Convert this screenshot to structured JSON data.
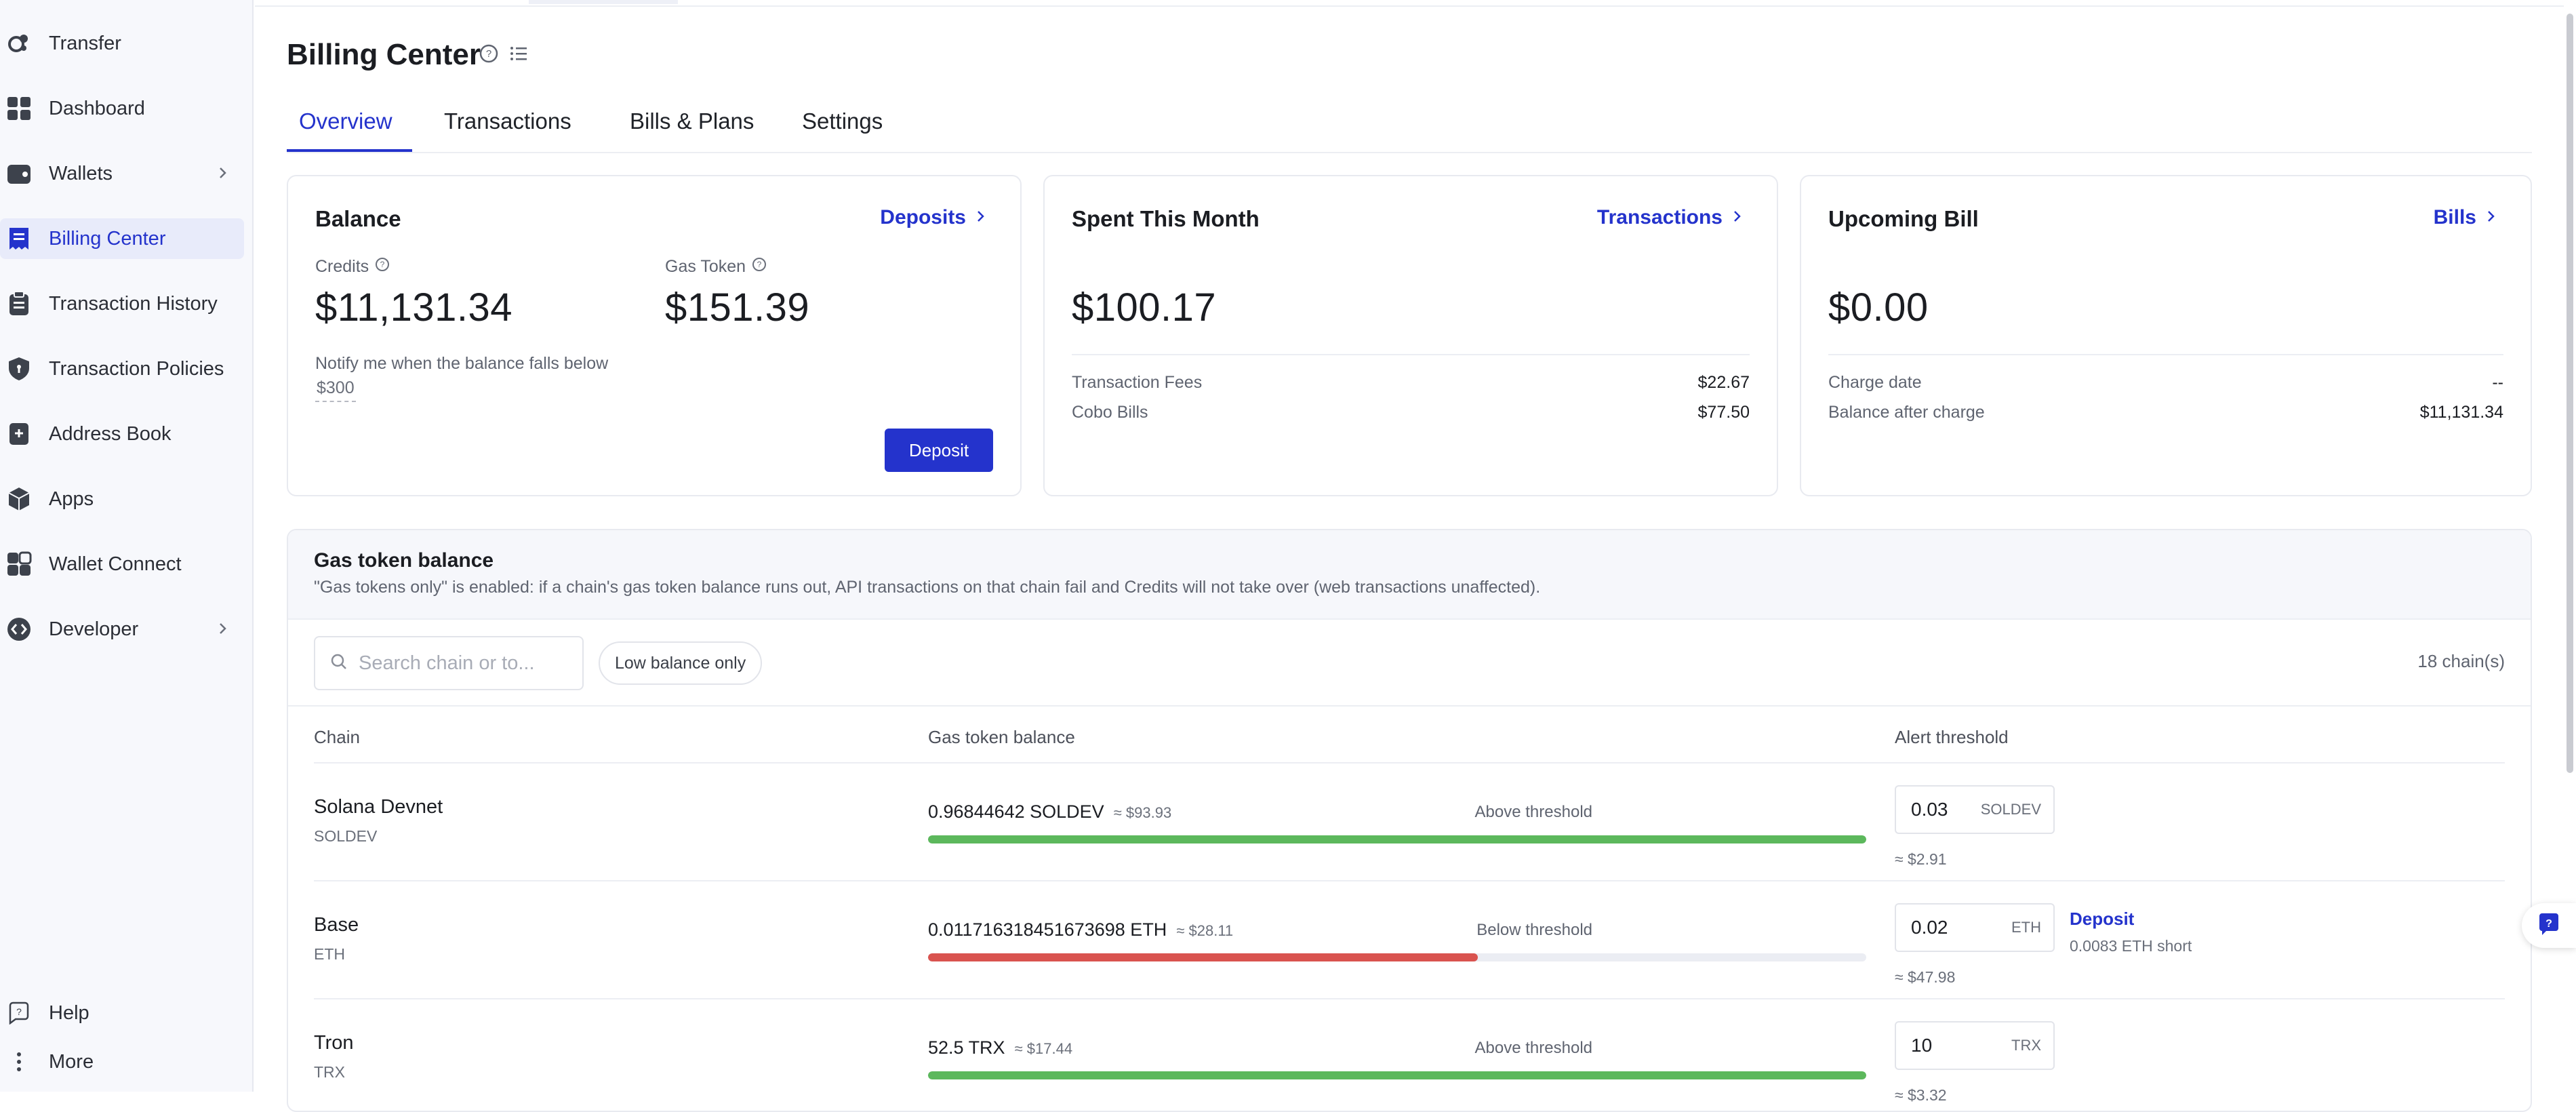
{
  "sidebar": {
    "items": [
      {
        "label": "Transfer",
        "icon": "transfer-icon"
      },
      {
        "label": "Dashboard",
        "icon": "dashboard-icon"
      },
      {
        "label": "Wallets",
        "icon": "wallet-icon"
      },
      {
        "label": "Billing Center",
        "icon": "billing-icon"
      },
      {
        "label": "Transaction History",
        "icon": "clipboard-icon"
      },
      {
        "label": "Transaction Policies",
        "icon": "shield-icon"
      },
      {
        "label": "Address Book",
        "icon": "address-book-icon"
      },
      {
        "label": "Apps",
        "icon": "cube-icon"
      },
      {
        "label": "Wallet Connect",
        "icon": "wallet-connect-icon"
      },
      {
        "label": "Developer",
        "icon": "code-icon"
      }
    ],
    "help": "Help",
    "more": "More"
  },
  "page": {
    "title": "Billing Center",
    "tabs": [
      "Overview",
      "Transactions",
      "Bills & Plans",
      "Settings"
    ]
  },
  "balance": {
    "title": "Balance",
    "link": "Deposits",
    "credits_label": "Credits",
    "credits": "$11,131.34",
    "gas_label": "Gas Token",
    "gas": "$151.39",
    "notify": "Notify me when the balance falls below",
    "notify_value": "$300",
    "deposit_button": "Deposit"
  },
  "spent": {
    "title": "Spent This Month",
    "link": "Transactions",
    "amount": "$100.17",
    "rows": [
      {
        "label": "Transaction Fees",
        "value": "$22.67"
      },
      {
        "label": "Cobo Bills",
        "value": "$77.50"
      }
    ]
  },
  "upcoming": {
    "title": "Upcoming Bill",
    "link": "Bills",
    "amount": "$0.00",
    "rows": [
      {
        "label": "Charge date",
        "value": "--"
      },
      {
        "label": "Balance after charge",
        "value": "$11,131.34"
      }
    ]
  },
  "gas_panel": {
    "title": "Gas token balance",
    "description": "\"Gas tokens only\" is enabled: if a chain's gas token balance runs out, API transactions on that chain fail and Credits will not take over (web transactions unaffected).",
    "search_placeholder": "Search chain or to...",
    "low_balance_chip": "Low balance only",
    "chain_count": "18 chain(s)",
    "headers": {
      "chain": "Chain",
      "balance": "Gas token balance",
      "alert": "Alert threshold"
    },
    "rows": [
      {
        "chain": "Solana Devnet",
        "symbol": "SOLDEV",
        "balance": "0.96844642 SOLDEV",
        "usd": "≈ $93.93",
        "status": "Above threshold",
        "level": 1.0,
        "bar_color": "#5cb85c",
        "threshold": "0.03",
        "unit": "SOLDEV",
        "threshold_usd": "≈ $2.91"
      },
      {
        "chain": "Base",
        "symbol": "ETH",
        "balance": "0.011716318451673698 ETH",
        "usd": "≈ $28.11",
        "status": "Below threshold",
        "level": 0.586,
        "bar_color": "#d9534f",
        "threshold": "0.02",
        "unit": "ETH",
        "threshold_usd": "≈ $47.98",
        "deposit": "Deposit",
        "short": "0.0083 ETH short"
      },
      {
        "chain": "Tron",
        "symbol": "TRX",
        "balance": "52.5 TRX",
        "usd": "≈ $17.44",
        "status": "Above threshold",
        "level": 1.0,
        "bar_color": "#5cb85c",
        "threshold": "10",
        "unit": "TRX",
        "threshold_usd": "≈ $3.32"
      }
    ]
  },
  "colors": {
    "accent": "#2433cc",
    "ok": "#5cb85c",
    "danger": "#d9534f"
  }
}
